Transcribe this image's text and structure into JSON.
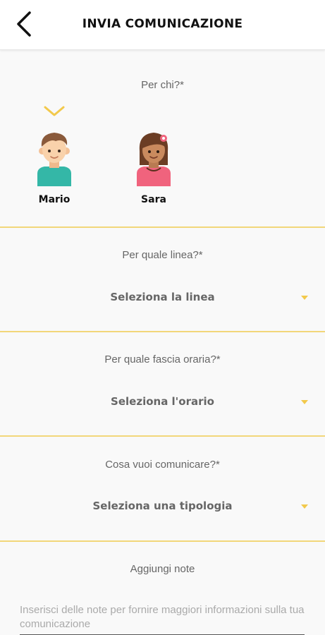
{
  "header": {
    "title": "INVIA COMUNICAZIONE",
    "back_icon": "chevron-left-icon"
  },
  "recipients": {
    "question": "Per chi?*",
    "selected_indicator_icon": "chevron-down-icon",
    "children": [
      {
        "name": "Mario",
        "avatar": "boy-avatar"
      },
      {
        "name": "Sara",
        "avatar": "girl-avatar"
      }
    ]
  },
  "line": {
    "question": "Per quale linea?*",
    "select_label": "Seleziona la linea"
  },
  "timeslot": {
    "question": "Per quale fascia oraria?*",
    "select_label": "Seleziona l'orario"
  },
  "type": {
    "question": "Cosa vuoi comunicare?*",
    "select_label": "Seleziona una tipologia"
  },
  "notes": {
    "label": "Aggiungi note",
    "placeholder": "Inserisci delle note per fornire maggiori informazioni sulla tua comunicazione"
  },
  "colors": {
    "accent": "#f2c94c",
    "divider": "#f2d77a",
    "background": "#f9f9f9"
  }
}
